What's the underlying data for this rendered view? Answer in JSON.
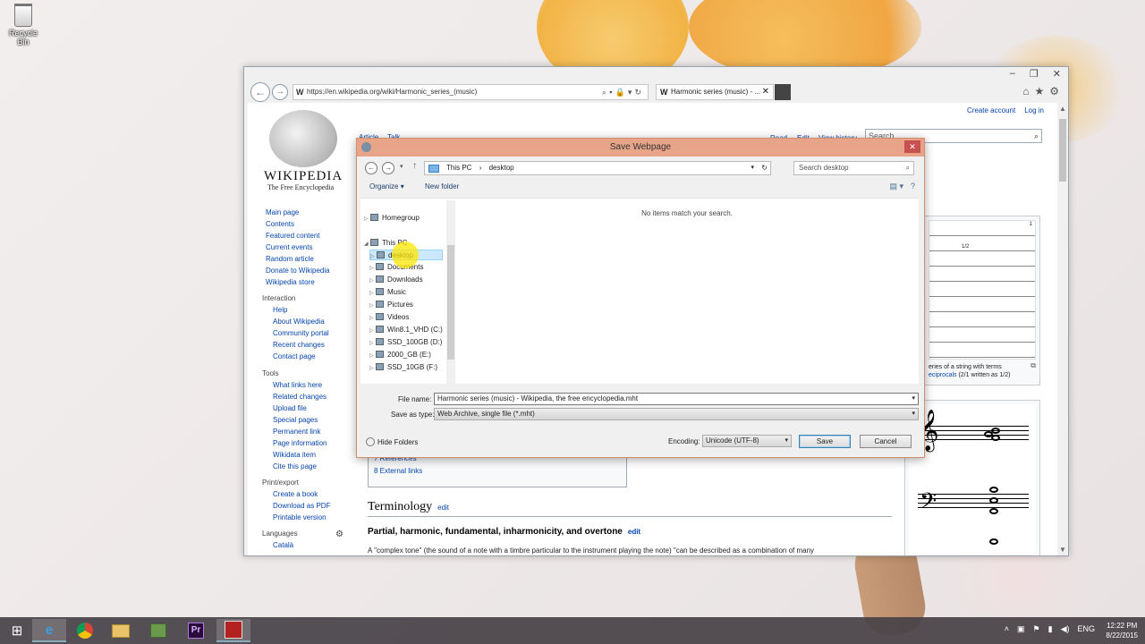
{
  "desktop": {
    "recycle_bin_label": "Recycle Bin"
  },
  "browser": {
    "url": "https://en.wikipedia.org/wiki/Harmonic_series_(music)",
    "tab_title": "Harmonic series (music) - ...",
    "window_buttons": [
      "–",
      "❐",
      "✕"
    ]
  },
  "wiki": {
    "logo_title": "WIKIPEDIA",
    "logo_subtitle": "The Free Encyclopedia",
    "top_links": [
      "Create account",
      "Log in"
    ],
    "search_placeholder": "Search",
    "page_tabs": {
      "article": "Article",
      "talk": "Talk",
      "read": "Read",
      "edit": "Edit",
      "view_history": "View history"
    },
    "nav": [
      "Main page",
      "Contents",
      "Featured content",
      "Current events",
      "Random article",
      "Donate to Wikipedia",
      "Wikipedia store"
    ],
    "interaction_heading": "Interaction",
    "interaction": [
      "Help",
      "About Wikipedia",
      "Community portal",
      "Recent changes",
      "Contact page"
    ],
    "tools_heading": "Tools",
    "tools": [
      "What links here",
      "Related changes",
      "Upload file",
      "Special pages",
      "Permanent link",
      "Page information",
      "Wikidata item",
      "Cite this page"
    ],
    "print_heading": "Print/export",
    "print": [
      "Create a book",
      "Download as PDF",
      "Printable version"
    ],
    "languages_heading": "Languages",
    "languages": [
      "Català"
    ],
    "toc_items": [
      "7 References",
      "8 External links"
    ],
    "section_title": "Terminology",
    "edit_label": "edit",
    "subsection_title": "Partial, harmonic, fundamental, inharmonicity, and overtone",
    "paragraph_start": "A \"complex tone\" (the sound of a note with a timbre particular to the instrument playing the note) \"can be described as a combination of many",
    "figure1_caption_line1": "eries of a string with terms",
    "figure1_caption_line2_link": "eciprocals",
    "figure1_caption_line2_rest": " (2/1 written as 1/2)",
    "figure1_labels": [
      "1",
      "1/2"
    ]
  },
  "dialog": {
    "title": "Save Webpage",
    "breadcrumb": [
      "This PC",
      "desktop"
    ],
    "search_placeholder": "Search desktop",
    "organize_label": "Organize",
    "new_folder_label": "New folder",
    "tree": [
      {
        "label": "Homegroup",
        "level": 0
      },
      {
        "label": "This PC",
        "level": 0
      },
      {
        "label": "desktop",
        "level": 1,
        "selected": true
      },
      {
        "label": "Documents",
        "level": 1
      },
      {
        "label": "Downloads",
        "level": 1
      },
      {
        "label": "Music",
        "level": 1
      },
      {
        "label": "Pictures",
        "level": 1
      },
      {
        "label": "Videos",
        "level": 1
      },
      {
        "label": "Win8.1_VHD (C:)",
        "level": 1
      },
      {
        "label": "SSD_100GB (D:)",
        "level": 1
      },
      {
        "label": "2000_GB (E:)",
        "level": 1
      },
      {
        "label": "SSD_10GB (F:)",
        "level": 1
      }
    ],
    "empty_message": "No items match your search.",
    "file_name_label": "File name:",
    "file_name_value": "Harmonic series (music) - Wikipedia, the free encyclopedia.mht",
    "save_type_label": "Save as type:",
    "save_type_value": "Web Archive, single file (*.mht)",
    "hide_folders_label": "Hide Folders",
    "encoding_label": "Encoding:",
    "encoding_value": "Unicode (UTF-8)",
    "save_label": "Save",
    "cancel_label": "Cancel"
  },
  "taskbar": {
    "language": "ENG",
    "time": "12:22 PM",
    "date": "8/22/2015"
  }
}
